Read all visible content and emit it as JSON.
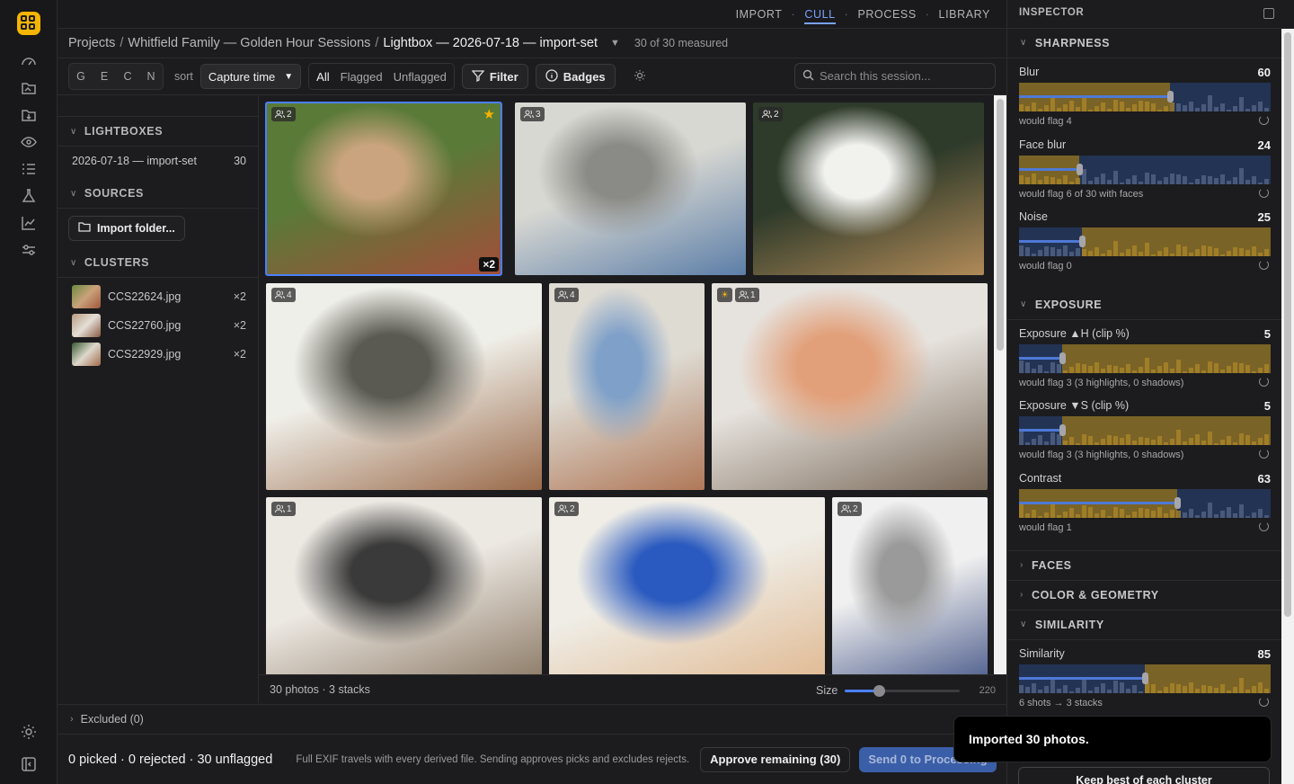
{
  "nav": {
    "items": [
      "IMPORT",
      "CULL",
      "PROCESS",
      "LIBRARY"
    ],
    "active": "CULL",
    "sep": "·"
  },
  "breadcrumb": {
    "projects": "Projects",
    "project": "Whitfield Family — Golden Hour Sessions",
    "current": "Lightbox — 2026-07-18 — import-set",
    "measured": "30 of 30 measured",
    "sep": "/"
  },
  "toolbar": {
    "gecn": [
      "G",
      "E",
      "C",
      "N"
    ],
    "sort_label": "sort",
    "sort_value": "Capture time",
    "filters": [
      "All",
      "Flagged",
      "Unflagged"
    ],
    "filters_active": "All",
    "filter_button": "Filter",
    "badges_button": "Badges",
    "search_placeholder": "Search this session..."
  },
  "left": {
    "lightboxes_title": "LIGHTBOXES",
    "lightbox": {
      "name": "2026-07-18 — import-set",
      "count": "30"
    },
    "sources_title": "SOURCES",
    "import_button": "Import folder...",
    "clusters_title": "CLUSTERS",
    "clusters": [
      {
        "name": "CCS22624.jpg",
        "count": "×2"
      },
      {
        "name": "CCS22760.jpg",
        "count": "×2"
      },
      {
        "name": "CCS22929.jpg",
        "count": "×2"
      }
    ]
  },
  "grid": {
    "photos": [
      {
        "faces": "2",
        "stack": "×2",
        "star": true,
        "selected": true,
        "colors": [
          "#5a7a38",
          "#caa47e",
          "#a24e3a"
        ]
      },
      {
        "faces": "3",
        "colors": [
          "#d8d8d2",
          "#8a8a86",
          "#5c7ea8"
        ]
      },
      {
        "faces": "2",
        "colors": [
          "#2e3a2a",
          "#f1f1ee",
          "#b08a58"
        ]
      },
      {
        "faces": "4",
        "colors": [
          "#efefe9",
          "#5a5a52",
          "#9a6a4a"
        ]
      },
      {
        "faces": "4",
        "colors": [
          "#dedbd3",
          "#7fa0c8",
          "#b07858"
        ]
      },
      {
        "faces": "1",
        "sun": true,
        "colors": [
          "#e6e2dd",
          "#e2a07a",
          "#7a6a5a"
        ]
      },
      {
        "faces": "1",
        "colors": [
          "#ece8e2",
          "#3a3a3a",
          "#8a7864"
        ]
      },
      {
        "faces": "2",
        "colors": [
          "#efede6",
          "#2a5abf",
          "#e0b890"
        ]
      },
      {
        "faces": "2",
        "colors": [
          "#f0f0f0",
          "#9a9a9a",
          "#4a5a8a"
        ]
      }
    ]
  },
  "grid_footer": {
    "summary": "30 photos · 3 stacks",
    "size_label": "Size",
    "size_max": "220",
    "size_fraction": 0.3
  },
  "excluded": "Excluded (0)",
  "bottom": {
    "summary": "0 picked · 0 rejected · 30 unflagged",
    "note": "Full EXIF travels with every derived file.  Sending approves picks and excludes rejects.",
    "approve": "Approve remaining (30)",
    "send": "Send 0 to Processing"
  },
  "inspector": {
    "title": "INSPECTOR",
    "sections": {
      "sharpness": "SHARPNESS",
      "exposure": "EXPOSURE",
      "faces": "FACES",
      "color": "COLOR & GEOMETRY",
      "similarity": "SIMILARITY"
    },
    "metrics": [
      {
        "name": "Blur",
        "value": "60",
        "foot": "would flag 4",
        "knob": 0.6,
        "flagged_side": "right"
      },
      {
        "name": "Face blur",
        "value": "24",
        "foot": "would flag 6 of 30 with faces",
        "knob": 0.24,
        "flagged_side": "right"
      },
      {
        "name": "Noise",
        "value": "25",
        "foot": "would flag 0",
        "knob": 0.25,
        "flagged_side": "left"
      },
      {
        "name": "Exposure ▲H (clip %)",
        "value": "5",
        "foot": "would flag 3 (3 highlights, 0 shadows)",
        "knob": 0.17,
        "flagged_side": "left"
      },
      {
        "name": "Exposure ▼S (clip %)",
        "value": "5",
        "foot": "would flag 3 (3 highlights, 0 shadows)",
        "knob": 0.17,
        "flagged_side": "left"
      },
      {
        "name": "Contrast",
        "value": "63",
        "foot": "would flag 1",
        "knob": 0.63,
        "flagged_side": "right"
      },
      {
        "name": "Similarity",
        "value": "85",
        "foot": "6 shots → 3 stacks",
        "knob": 0.5,
        "flagged_side": "left"
      }
    ],
    "keep_button": "Keep best of each cluster"
  },
  "toast": "Imported 30 photos."
}
